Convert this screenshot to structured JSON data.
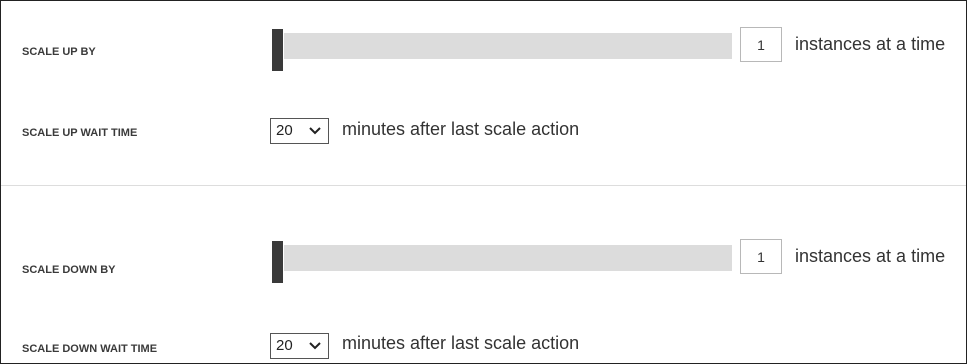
{
  "scale_up": {
    "by_label": "SCALE UP BY",
    "instances_value": "1",
    "instances_suffix": "instances at a time",
    "slider_level": 0,
    "wait_label": "SCALE UP WAIT TIME",
    "wait_value": "20",
    "wait_suffix": "minutes after last scale action"
  },
  "scale_down": {
    "by_label": "SCALE DOWN BY",
    "instances_value": "1",
    "instances_suffix": "instances at a time",
    "slider_level": 0,
    "wait_label": "SCALE DOWN WAIT TIME",
    "wait_value": "20",
    "wait_suffix": "minutes after last scale action"
  },
  "icons": {
    "dropdown": "chevron-down-icon"
  },
  "colors": {
    "slider_thumb": "#3a3a3a",
    "slider_track": "#dcdcdc",
    "divider": "#dddddd"
  }
}
